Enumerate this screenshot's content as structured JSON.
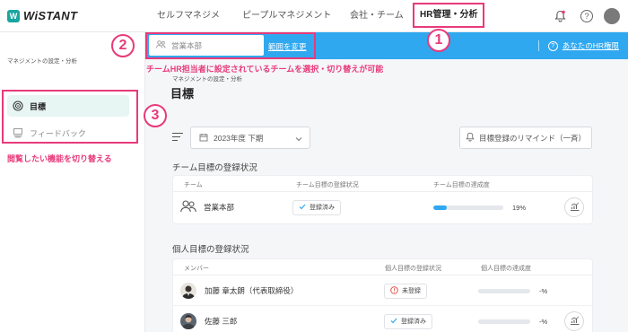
{
  "app": {
    "logo_text": "WiSTANT",
    "logo_mark": "W"
  },
  "nav": {
    "items": [
      "セルフマネジメント",
      "ピープルマネジメント",
      "会社・チーム",
      "HR管理・分析"
    ],
    "active_index": 3
  },
  "header_icons": [
    "bell-icon",
    "help-icon",
    "user-avatar"
  ],
  "sidebar": {
    "caption": "マネジメントの設定・分析",
    "items": [
      {
        "label": "目標",
        "icon": "target-icon",
        "active": true
      },
      {
        "label": "フィードバック",
        "icon": "feedback-icon",
        "active": false
      }
    ],
    "annotation": "閲覧したい機能を切り替える"
  },
  "bluebar": {
    "dept_value": "営業本部",
    "change_link": "範囲を変更",
    "hr_auth_label": "あなたのHR権限",
    "hr_auth_icon": "?"
  },
  "annotations": {
    "badge1": "1",
    "badge2": "2",
    "badge3": "3",
    "top_text": "チームHR担当者に設定されているチームを選択・切り替えが可能"
  },
  "main": {
    "breadcrumb": "マネジメントの設定・分析",
    "title": "目標",
    "period": "2023年度 下期",
    "remind_button": "目標登録のリマインド（一斉）",
    "team_section": {
      "title": "チーム目標の登録状況",
      "headers": {
        "team": "チーム",
        "status": "チーム目標の登録状況",
        "progress": "チーム目標の達成度"
      },
      "rows": [
        {
          "name": "営業本部",
          "status": "登録済み",
          "progress": 19,
          "progress_text": "19%"
        }
      ]
    },
    "member_section": {
      "title": "個人目標の登録状況",
      "headers": {
        "member": "メンバー",
        "status": "個人目標の登録状況",
        "progress": "個人目標の達成度"
      },
      "rows": [
        {
          "name": "加藤 章太朗（代表取締役）",
          "status": "未登録",
          "status_type": "unregistered",
          "progress_text": "-%"
        },
        {
          "name": "佐藤 三郎",
          "status": "登録済み",
          "status_type": "registered",
          "progress_text": "-%"
        }
      ]
    }
  },
  "colors": {
    "accent": "#e83a7a",
    "blue": "#2fa8f0",
    "teal": "#1aa5a0"
  }
}
